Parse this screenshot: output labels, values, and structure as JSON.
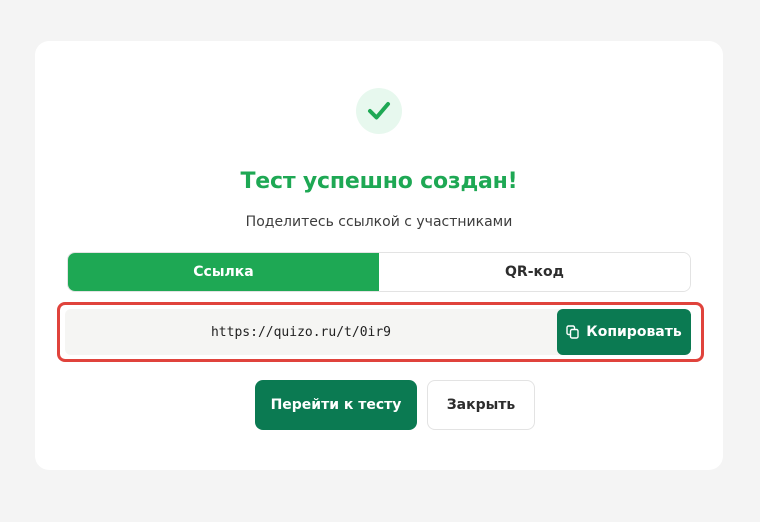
{
  "colors": {
    "accent_green": "#1ea854",
    "dark_green": "#0b7a52",
    "highlight_red": "#e0433c"
  },
  "dialog": {
    "success_icon": "check-icon",
    "title": "Тест успешно создан!",
    "subtitle": "Поделитесь ссылкой с участниками"
  },
  "tabs": [
    {
      "label": "Ссылка",
      "active": true
    },
    {
      "label": "QR-код",
      "active": false
    }
  ],
  "share": {
    "link": "https://quizo.ru/t/0ir9",
    "copy_icon": "copy-icon",
    "copy_label": "Копировать"
  },
  "actions": {
    "go_label": "Перейти к тесту",
    "close_label": "Закрыть"
  }
}
